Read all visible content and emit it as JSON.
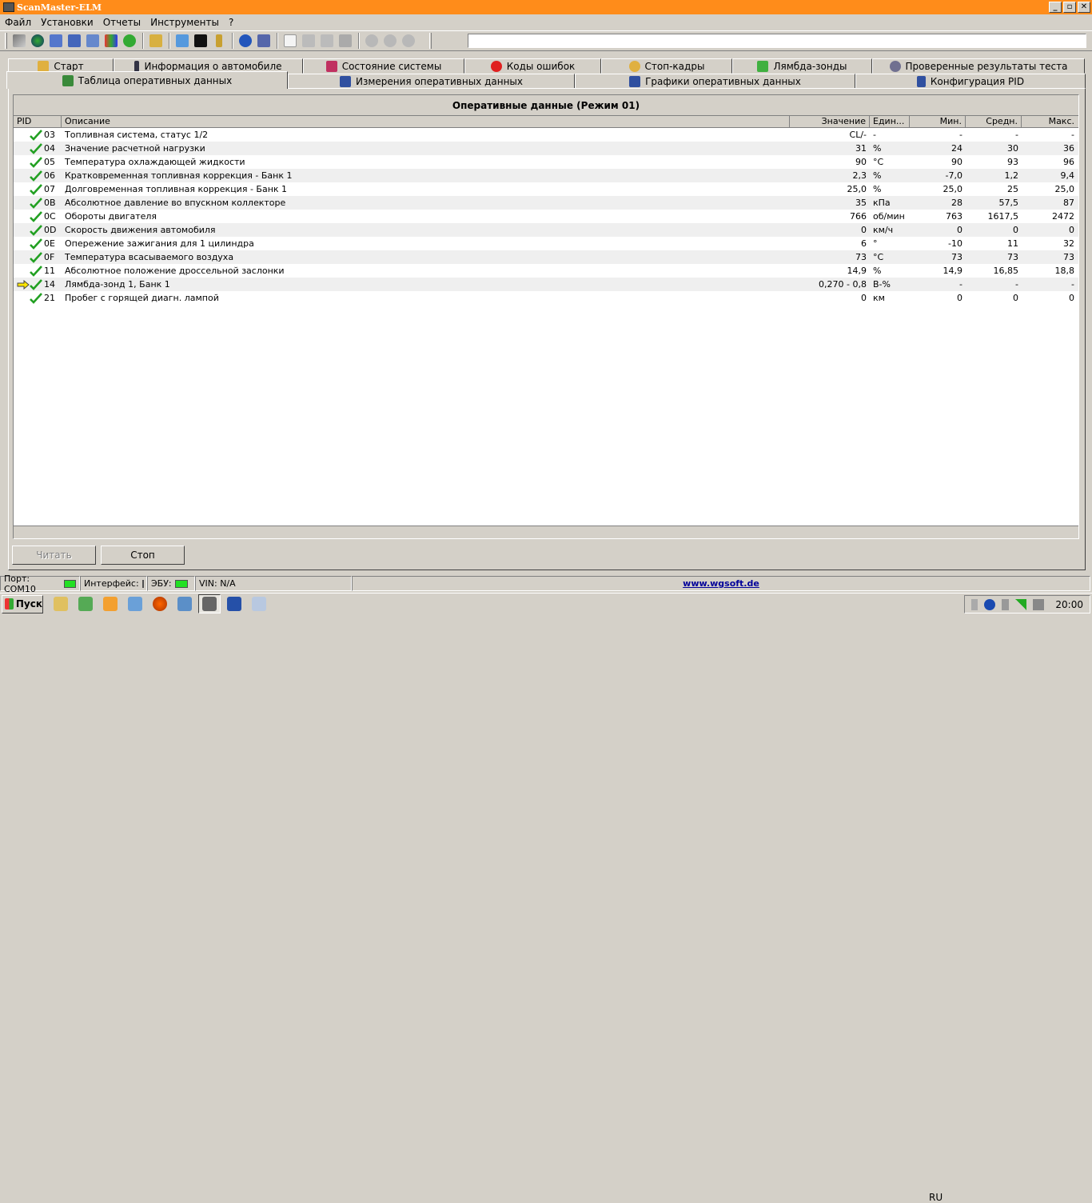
{
  "window": {
    "title": "ScanMaster-ELM"
  },
  "window_buttons": [
    "_",
    "▫",
    "✕"
  ],
  "menu": [
    "Файл",
    "Установки",
    "Отчеты",
    "Инструменты",
    "?"
  ],
  "tabs_row1": [
    {
      "label": "Старт",
      "icon": "home-icon",
      "color": "#e0b040"
    },
    {
      "label": "Информация о автомобиле",
      "icon": "info-icon",
      "color": "#334"
    },
    {
      "label": "Состояние системы",
      "icon": "checkbox-icon",
      "color": "#c03060"
    },
    {
      "label": "Коды ошибок",
      "icon": "error-icon",
      "color": "#e02020"
    },
    {
      "label": "Стоп-кадры",
      "icon": "hand-icon",
      "color": "#e0b040"
    },
    {
      "label": "Лямбда-зонды",
      "icon": "grid-icon",
      "color": "#40b040"
    },
    {
      "label": "Проверенные результаты теста",
      "icon": "gear-icon",
      "color": "#707090"
    }
  ],
  "tabs_row2": [
    {
      "label": "Таблица оперативных данных",
      "icon": "list-icon",
      "color": "#3a8a3a",
      "active": true
    },
    {
      "label": "Измерения оперативных данных",
      "icon": "table-icon",
      "color": "#3050a0"
    },
    {
      "label": "Графики оперативных данных",
      "icon": "chart-icon",
      "color": "#3050a0"
    },
    {
      "label": "Конфигурация PID",
      "icon": "document-icon",
      "color": "#3050a0"
    }
  ],
  "table": {
    "caption": "Оперативные данные (Режим 01)",
    "columns": [
      "PID",
      "Описание",
      "Значение",
      "Един...",
      "Мин.",
      "Средн.",
      "Макс."
    ],
    "rows": [
      {
        "pid": "03",
        "desc": "Топливная система, статус 1/2",
        "value": "CL/-",
        "unit": "-",
        "min": "-",
        "avg": "-",
        "max": "-"
      },
      {
        "pid": "04",
        "desc": "Значение расчетной нагрузки",
        "value": "31",
        "unit": "%",
        "min": "24",
        "avg": "30",
        "max": "36"
      },
      {
        "pid": "05",
        "desc": "Температура охлаждающей жидкости",
        "value": "90",
        "unit": "°C",
        "min": "90",
        "avg": "93",
        "max": "96"
      },
      {
        "pid": "06",
        "desc": "Кратковременная топливная коррекция - Банк 1",
        "value": "2,3",
        "unit": "%",
        "min": "-7,0",
        "avg": "1,2",
        "max": "9,4"
      },
      {
        "pid": "07",
        "desc": "Долговременная топливная коррекция - Банк 1",
        "value": "25,0",
        "unit": "%",
        "min": "25,0",
        "avg": "25",
        "max": "25,0"
      },
      {
        "pid": "0B",
        "desc": "Абсолютное давление во впускном коллекторе",
        "value": "35",
        "unit": "кПа",
        "min": "28",
        "avg": "57,5",
        "max": "87"
      },
      {
        "pid": "0C",
        "desc": "Обороты двигателя",
        "value": "766",
        "unit": "об/мин",
        "min": "763",
        "avg": "1617,5",
        "max": "2472"
      },
      {
        "pid": "0D",
        "desc": "Скорость движения автомобиля",
        "value": "0",
        "unit": "км/ч",
        "min": "0",
        "avg": "0",
        "max": "0"
      },
      {
        "pid": "0E",
        "desc": "Опережение зажигания для 1 цилиндра",
        "value": "6",
        "unit": "°",
        "min": "-10",
        "avg": "11",
        "max": "32"
      },
      {
        "pid": "0F",
        "desc": "Температура  всасываемого воздуха",
        "value": "73",
        "unit": "°C",
        "min": "73",
        "avg": "73",
        "max": "73"
      },
      {
        "pid": "11",
        "desc": "Абсолютное положение дроссельной заслонки",
        "value": "14,9",
        "unit": "%",
        "min": "14,9",
        "avg": "16,85",
        "max": "18,8"
      },
      {
        "pid": "14",
        "desc": "Лямбда-зонд 1, Банк 1",
        "value": "0,270 - 0,8",
        "unit": "В-%",
        "min": "-",
        "avg": "-",
        "max": "-",
        "current": true
      },
      {
        "pid": "21",
        "desc": "Пробег с горящей диагн. лампой",
        "value": "0",
        "unit": "км",
        "min": "0",
        "avg": "0",
        "max": "0"
      }
    ]
  },
  "buttons": {
    "read": "Читать",
    "stop": "Стоп"
  },
  "status": {
    "port": "Порт:  COM10",
    "interface": "Интерфейс:",
    "ecu": "ЭБУ:",
    "vin": "VIN: N/A",
    "link": "www.wgsoft.de",
    "led_color": "#22e022"
  },
  "taskbar": {
    "start": "Пуск",
    "lang": "RU",
    "clock": "20:00"
  }
}
